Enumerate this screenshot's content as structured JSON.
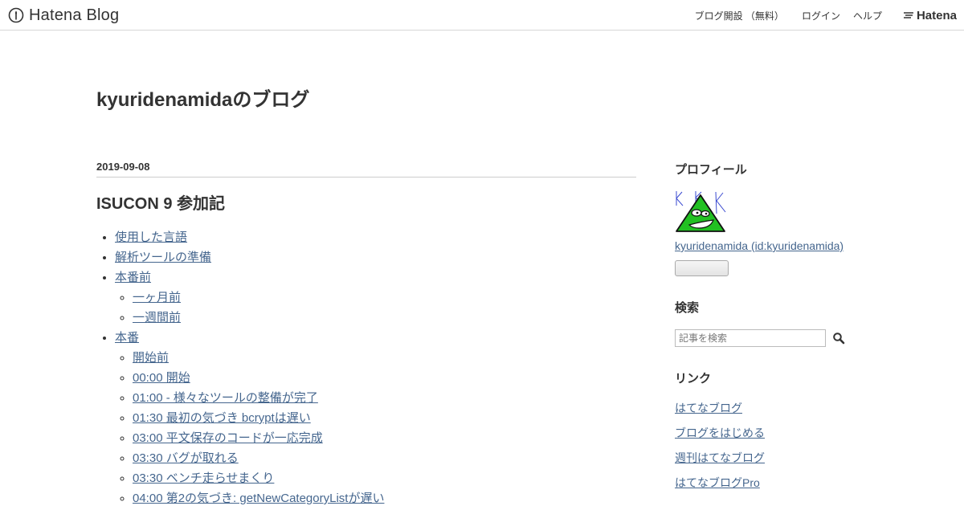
{
  "header": {
    "logo_text": "Hatena Blog",
    "nav": {
      "signup": "ブログ開設 （無料）",
      "login": "ログイン",
      "help": "ヘルプ",
      "hatena": "Hatena"
    }
  },
  "blog": {
    "title": "kyuridenamidaのブログ"
  },
  "entry": {
    "date": "2019-09-08",
    "title": "ISUCON 9 参加記",
    "toc": [
      {
        "label": "使用した言語"
      },
      {
        "label": "解析ツールの準備"
      },
      {
        "label": "本番前",
        "children": [
          "一ヶ月前",
          "一週間前"
        ]
      },
      {
        "label": "本番",
        "children": [
          "開始前",
          "00:00 開始",
          "01:00 - 様々なツールの整備が完了",
          "01:30 最初の気づき bcryptは遅い",
          "03:00 平文保存のコードが一応完成",
          "03:30 バグが取れる",
          "03:30 ベンチ走らせまくり",
          "04:00 第2の気づき: getNewCategoryListが遅い"
        ]
      }
    ]
  },
  "sidebar": {
    "profile": {
      "heading": "プロフィール",
      "name": "kyuridenamida (id:kyuridenamida)",
      "icon": "green-triangle-avatar"
    },
    "search": {
      "heading": "検索",
      "placeholder": "記事を検索",
      "icon": "search-icon"
    },
    "links": {
      "heading": "リンク",
      "items": [
        "はてなブログ",
        "ブログをはじめる",
        "週刊はてなブログ",
        "はてなブログPro"
      ]
    }
  },
  "colors": {
    "link": "#45668e",
    "text": "#333333",
    "avatar_green": "#22c022"
  }
}
